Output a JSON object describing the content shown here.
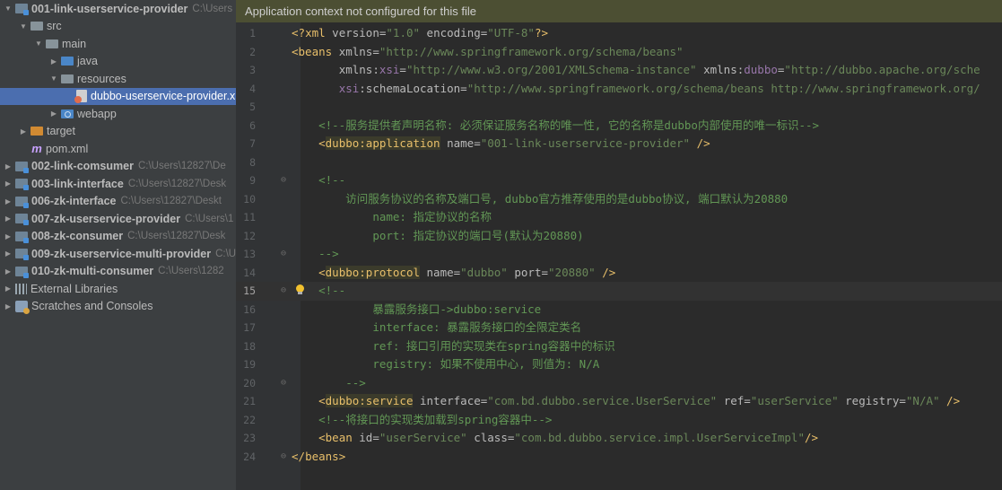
{
  "tree": {
    "items": [
      {
        "label": "001-link-userservice-provider",
        "path": "C:\\Users",
        "indent": 0,
        "arrow": "down",
        "icon": "module-icon",
        "bold": true
      },
      {
        "label": "src",
        "path": "",
        "indent": 1,
        "arrow": "down",
        "icon": "folder-icon"
      },
      {
        "label": "main",
        "path": "",
        "indent": 2,
        "arrow": "down",
        "icon": "folder-icon"
      },
      {
        "label": "java",
        "path": "",
        "indent": 3,
        "arrow": "right",
        "icon": "source-folder-icon"
      },
      {
        "label": "resources",
        "path": "",
        "indent": 3,
        "arrow": "down",
        "icon": "resources-folder-icon"
      },
      {
        "label": "dubbo-userservice-provider.xml",
        "path": "",
        "indent": 4,
        "arrow": "none",
        "icon": "xml-file-icon",
        "selected": true
      },
      {
        "label": "webapp",
        "path": "",
        "indent": 3,
        "arrow": "right",
        "icon": "web-folder-icon"
      },
      {
        "label": "target",
        "path": "",
        "indent": 1,
        "arrow": "right",
        "icon": "excluded-folder-icon"
      },
      {
        "label": "pom.xml",
        "path": "",
        "indent": 1,
        "arrow": "none",
        "icon": "maven-icon"
      },
      {
        "label": "002-link-comsumer",
        "path": "C:\\Users\\12827\\De",
        "indent": 0,
        "arrow": "right",
        "icon": "module-icon",
        "bold": true
      },
      {
        "label": "003-link-interface",
        "path": "C:\\Users\\12827\\Desk",
        "indent": 0,
        "arrow": "right",
        "icon": "module-icon",
        "bold": true
      },
      {
        "label": "006-zk-interface",
        "path": "C:\\Users\\12827\\Deskt",
        "indent": 0,
        "arrow": "right",
        "icon": "module-icon",
        "bold": true
      },
      {
        "label": "007-zk-userservice-provider",
        "path": "C:\\Users\\1",
        "indent": 0,
        "arrow": "right",
        "icon": "module-icon",
        "bold": true
      },
      {
        "label": "008-zk-consumer",
        "path": "C:\\Users\\12827\\Desk",
        "indent": 0,
        "arrow": "right",
        "icon": "module-icon",
        "bold": true
      },
      {
        "label": "009-zk-userservice-multi-provider",
        "path": "C:\\U",
        "indent": 0,
        "arrow": "right",
        "icon": "module-icon",
        "bold": true
      },
      {
        "label": "010-zk-multi-consumer",
        "path": "C:\\Users\\1282",
        "indent": 0,
        "arrow": "right",
        "icon": "module-icon",
        "bold": true
      },
      {
        "label": "External Libraries",
        "path": "",
        "indent": 0,
        "arrow": "right",
        "icon": "libraries-icon"
      },
      {
        "label": "Scratches and Consoles",
        "path": "",
        "indent": 0,
        "arrow": "right",
        "icon": "scratches-icon"
      }
    ]
  },
  "editor": {
    "banner": "Application context not configured for this file",
    "current_line": 15,
    "lines": [
      {
        "n": "1",
        "fold": "",
        "tokens": [
          [
            "punc",
            "<?"
          ],
          [
            "tag",
            "xml "
          ],
          [
            "attr",
            "version="
          ],
          [
            "val",
            "\"1.0\" "
          ],
          [
            "attr",
            "encoding="
          ],
          [
            "val",
            "\"UTF-8\""
          ],
          [
            "punc",
            "?>"
          ]
        ]
      },
      {
        "n": "2",
        "fold": "",
        "tokens": [
          [
            "punc",
            "<"
          ],
          [
            "tag",
            "beans "
          ],
          [
            "attr",
            "xmlns="
          ],
          [
            "val",
            "\"http://www.springframework.org/schema/beans\""
          ]
        ]
      },
      {
        "n": "3",
        "fold": "",
        "tokens": [
          [
            "plain",
            "       "
          ],
          [
            "attr",
            "xmlns:"
          ],
          [
            "ns",
            "xsi"
          ],
          [
            "attr",
            "="
          ],
          [
            "val",
            "\"http://www.w3.org/2001/XMLSchema-instance\" "
          ],
          [
            "attr",
            "xmlns:"
          ],
          [
            "ns",
            "dubbo"
          ],
          [
            "attr",
            "="
          ],
          [
            "val",
            "\"http://dubbo.apache.org/sche"
          ]
        ]
      },
      {
        "n": "4",
        "fold": "",
        "tokens": [
          [
            "plain",
            "       "
          ],
          [
            "ns",
            "xsi"
          ],
          [
            "attr",
            ":schemaLocation="
          ],
          [
            "val",
            "\"http://www.springframework.org/schema/beans http://www.springframework.org/"
          ]
        ]
      },
      {
        "n": "5",
        "fold": "",
        "tokens": []
      },
      {
        "n": "6",
        "fold": "",
        "tokens": [
          [
            "plain",
            "    "
          ],
          [
            "com",
            "<!--服务提供者声明名称: 必须保证服务名称的唯一性, 它的名称是dubbo内部使用的唯一标识-->"
          ]
        ]
      },
      {
        "n": "7",
        "fold": "",
        "tokens": [
          [
            "plain",
            "    "
          ],
          [
            "punc",
            "<"
          ],
          [
            "tagbg",
            "dubbo:application"
          ],
          [
            "attr",
            " name="
          ],
          [
            "val",
            "\"001-link-userservice-provider\" "
          ],
          [
            "punc",
            "/>"
          ]
        ]
      },
      {
        "n": "8",
        "fold": "",
        "tokens": []
      },
      {
        "n": "9",
        "fold": "open",
        "tokens": [
          [
            "plain",
            "    "
          ],
          [
            "com",
            "<!--"
          ]
        ]
      },
      {
        "n": "10",
        "fold": "",
        "tokens": [
          [
            "plain",
            "        "
          ],
          [
            "com",
            "访问服务协议的名称及端口号, dubbo官方推荐使用的是dubbo协议, 端口默认为20880"
          ]
        ]
      },
      {
        "n": "11",
        "fold": "",
        "tokens": [
          [
            "plain",
            "            "
          ],
          [
            "com",
            "name: 指定协议的名称"
          ]
        ]
      },
      {
        "n": "12",
        "fold": "",
        "tokens": [
          [
            "plain",
            "            "
          ],
          [
            "com",
            "port: 指定协议的端口号(默认为20880)"
          ]
        ]
      },
      {
        "n": "13",
        "fold": "close",
        "tokens": [
          [
            "plain",
            "    "
          ],
          [
            "com",
            "-->"
          ]
        ]
      },
      {
        "n": "14",
        "fold": "",
        "tokens": [
          [
            "plain",
            "    "
          ],
          [
            "punc",
            "<"
          ],
          [
            "tagbg",
            "dubbo:protocol"
          ],
          [
            "attr",
            " name="
          ],
          [
            "val",
            "\"dubbo\" "
          ],
          [
            "attr",
            "port="
          ],
          [
            "val",
            "\"20880\" "
          ],
          [
            "punc",
            "/>"
          ]
        ]
      },
      {
        "n": "15",
        "fold": "open",
        "tokens": [
          [
            "plain",
            "    "
          ],
          [
            "com",
            "<!--"
          ]
        ]
      },
      {
        "n": "16",
        "fold": "",
        "tokens": [
          [
            "plain",
            "            "
          ],
          [
            "com",
            "暴露服务接口->dubbo:service"
          ]
        ]
      },
      {
        "n": "17",
        "fold": "",
        "tokens": [
          [
            "plain",
            "            "
          ],
          [
            "com",
            "interface: 暴露服务接口的全限定类名"
          ]
        ]
      },
      {
        "n": "18",
        "fold": "",
        "tokens": [
          [
            "plain",
            "            "
          ],
          [
            "com",
            "ref: 接口引用的实现类在spring容器中的标识"
          ]
        ]
      },
      {
        "n": "19",
        "fold": "",
        "tokens": [
          [
            "plain",
            "            "
          ],
          [
            "com",
            "registry: 如果不使用中心, 则值为: N/A"
          ]
        ]
      },
      {
        "n": "20",
        "fold": "close",
        "tokens": [
          [
            "plain",
            "        "
          ],
          [
            "com",
            "-->"
          ]
        ]
      },
      {
        "n": "21",
        "fold": "",
        "tokens": [
          [
            "plain",
            "    "
          ],
          [
            "punc",
            "<"
          ],
          [
            "tagbg",
            "dubbo:service"
          ],
          [
            "attr",
            " interface="
          ],
          [
            "val",
            "\"com.bd.dubbo.service.UserService\" "
          ],
          [
            "attr",
            "ref="
          ],
          [
            "val",
            "\"userService\" "
          ],
          [
            "attr",
            "registry="
          ],
          [
            "val",
            "\"N/A\" "
          ],
          [
            "punc",
            "/>"
          ]
        ]
      },
      {
        "n": "22",
        "fold": "",
        "tokens": [
          [
            "plain",
            "    "
          ],
          [
            "com",
            "<!--将接口的实现类加载到spring容器中-->"
          ]
        ]
      },
      {
        "n": "23",
        "fold": "",
        "tokens": [
          [
            "plain",
            "    "
          ],
          [
            "punc",
            "<"
          ],
          [
            "tag",
            "bean "
          ],
          [
            "attr",
            "id="
          ],
          [
            "val",
            "\"userService\" "
          ],
          [
            "attr",
            "class="
          ],
          [
            "val",
            "\"com.bd.dubbo.service.impl.UserServiceImpl\""
          ],
          [
            "punc",
            "/>"
          ]
        ]
      },
      {
        "n": "24",
        "fold": "close",
        "tokens": [
          [
            "punc",
            "</"
          ],
          [
            "tag",
            "beans"
          ],
          [
            "punc",
            ">"
          ]
        ]
      }
    ]
  }
}
